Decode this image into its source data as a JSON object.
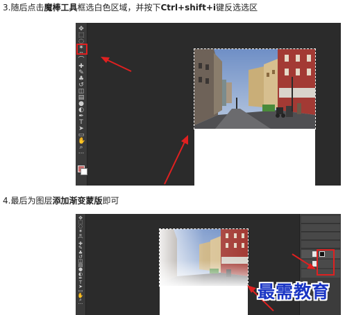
{
  "step3": {
    "prefix": "3.随后点击",
    "tool_name": "魔棒工具",
    "middle": "框选白色区域，并按下",
    "shortcut": "Ctrl+shift+i",
    "suffix_key": "键",
    "suffix": "反选选区"
  },
  "step4": {
    "prefix": "4.最后为图层",
    "action": "添加渐变蒙版",
    "suffix": "即可"
  },
  "watermark": "最需教育",
  "toolbar": {
    "tools": [
      "move-tool",
      "marquee-tool",
      "lasso-tool",
      "magic-wand-tool",
      "crop-tool",
      "eyedropper-tool",
      "healing-brush-tool",
      "brush-tool",
      "clone-stamp-tool",
      "history-brush-tool",
      "eraser-tool",
      "gradient-tool",
      "blur-tool",
      "dodge-tool",
      "pen-tool",
      "type-tool",
      "path-selection-tool",
      "shape-tool",
      "hand-tool",
      "zoom-tool",
      "more-tools"
    ],
    "glyphs": [
      "✥",
      "⬚",
      "◌",
      "✶",
      "⌗",
      "⌒",
      "✚",
      "✎",
      "♣",
      "↺",
      "◫",
      "▤",
      "●",
      "◐",
      "✒",
      "T",
      "➤",
      "▭",
      "✋",
      "⌕",
      "···"
    ]
  },
  "colors": {
    "highlight": "#e02020",
    "arrow": "#e02020",
    "canvas_bg": "#2b2b2b",
    "watermark": "#1a35c4"
  }
}
